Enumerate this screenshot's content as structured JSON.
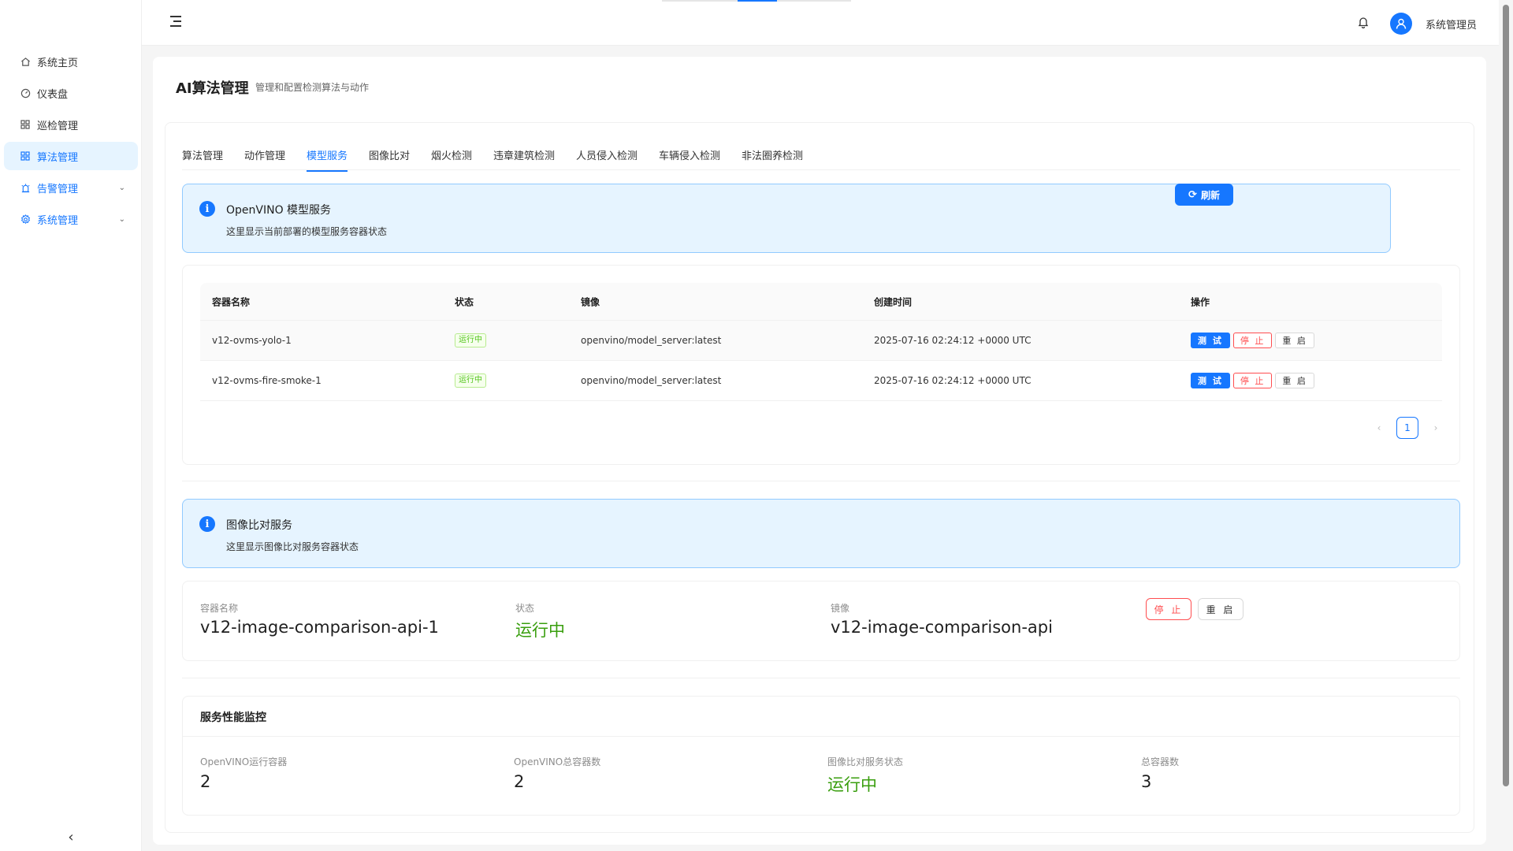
{
  "sidebar": {
    "items": [
      {
        "label": "系统主页",
        "icon": "home-icon"
      },
      {
        "label": "仪表盘",
        "icon": "dashboard-icon"
      },
      {
        "label": "巡检管理",
        "icon": "grid-icon"
      },
      {
        "label": "算法管理",
        "icon": "grid-icon"
      },
      {
        "label": "告警管理",
        "icon": "alarm-icon"
      },
      {
        "label": "系统管理",
        "icon": "gear-icon"
      }
    ]
  },
  "header": {
    "username": "系统管理员"
  },
  "page": {
    "title": "AI算法管理",
    "subtitle": "管理和配置检测算法与动作"
  },
  "tabs": [
    "算法管理",
    "动作管理",
    "模型服务",
    "图像比对",
    "烟火检测",
    "违章建筑检测",
    "人员侵入检测",
    "车辆侵入检测",
    "非法圈养检测"
  ],
  "openvino_alert": {
    "title": "OpenVINO 模型服务",
    "desc": "这里显示当前部署的模型服务容器状态"
  },
  "refresh_label": "刷新",
  "table": {
    "headers": [
      "容器名称",
      "状态",
      "镜像",
      "创建时间",
      "操作"
    ],
    "rows": [
      {
        "name": "v12-ovms-yolo-1",
        "status": "运行中",
        "image": "openvino/model_server:latest",
        "created": "2025-07-16 02:24:12 +0000 UTC"
      },
      {
        "name": "v12-ovms-fire-smoke-1",
        "status": "运行中",
        "image": "openvino/model_server:latest",
        "created": "2025-07-16 02:24:12 +0000 UTC"
      }
    ],
    "actions": {
      "test": "测 试",
      "stop": "停 止",
      "restart": "重 启"
    }
  },
  "pagination": {
    "current": "1"
  },
  "compare_alert": {
    "title": "图像比对服务",
    "desc": "这里显示图像比对服务容器状态"
  },
  "compare_card": {
    "name_label": "容器名称",
    "name_value": "v12-image-comparison-api-1",
    "status_label": "状态",
    "status_value": "运行中",
    "image_label": "镜像",
    "image_value": "v12-image-comparison-api",
    "stop": "停 止",
    "restart": "重 启"
  },
  "monitor": {
    "title": "服务性能监控",
    "stats": [
      {
        "label": "OpenVINO运行容器",
        "value": "2"
      },
      {
        "label": "OpenVINO总容器数",
        "value": "2"
      },
      {
        "label": "图像比对服务状态",
        "value": "运行中"
      },
      {
        "label": "总容器数",
        "value": "3"
      }
    ]
  },
  "colors": {
    "primary": "#1677ff",
    "success": "#389e0d",
    "danger": "#ff4d4f",
    "info_bg": "#e6f4ff"
  }
}
